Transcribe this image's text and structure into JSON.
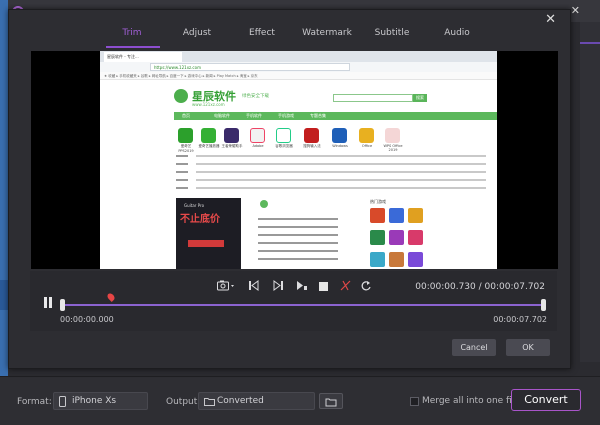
{
  "dialog": {
    "tabs": [
      "Trim",
      "Adjust",
      "Effect",
      "Watermark",
      "Subtitle",
      "Audio"
    ],
    "active_tab": "Trim",
    "close_icon": "close-icon",
    "accent_color": "#8d4ed0"
  },
  "preview": {
    "browser": {
      "tab_title": "星辰软件 - 专注...",
      "url": "https://www.121xz.com",
      "bookmarks": "★ 收藏 ▸ 手机收藏夹 ▸ 谷歌 ▸ 网址导航 ▸ 百度一下 ▸ 游戏中心 ▸ 新闻 ▸ Play Match ▸ 淘宝 ▸ 京东"
    },
    "site": {
      "logo_text": "星辰软件",
      "logo_url": "www.121xz.com",
      "slogan": "绿色安全下载",
      "search_button": "搜索",
      "nav_items": [
        "首页",
        "电脑软件",
        "手机软件",
        "手机游戏",
        "专题合集"
      ],
      "apps": [
        "爱奇艺PPS2019",
        "爱奇艺播放器",
        "王者荣耀助手",
        "Adobe",
        "谷歌浏览器",
        "搜狗输入法",
        "Windows",
        "Office",
        "WPS Office 2019"
      ],
      "ad_title": "不止底价",
      "ad_subtitle": "Guitar Pro",
      "side_title": "热门游戏"
    }
  },
  "controls": {
    "tools": [
      "camera-icon",
      "prev-frame-icon",
      "next-frame-icon",
      "mark-in-icon",
      "stop-icon",
      "cut-icon",
      "rotate-icon"
    ],
    "current_time": "00:00:00.730",
    "total_time": "00:00:07.702",
    "time_separator": " / ",
    "start_time": "00:00:00.000",
    "end_time": "00:00:07.702"
  },
  "buttons": {
    "cancel": "Cancel",
    "ok": "OK"
  },
  "bottom_bar": {
    "format_label": "Format:",
    "format_value": "iPhone Xs",
    "output_label": "Output:",
    "output_value": "Converted",
    "merge_label": "Merge all into one file",
    "convert_label": "Convert"
  }
}
